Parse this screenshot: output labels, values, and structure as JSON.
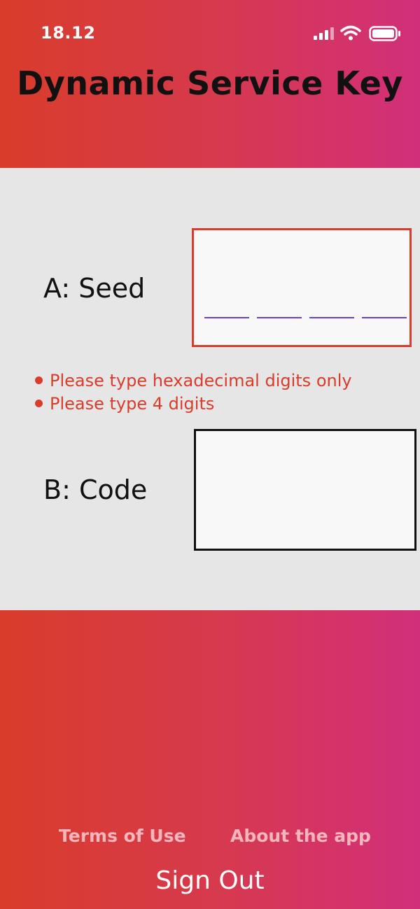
{
  "status_bar": {
    "time": "18.12",
    "icons": [
      "signal-icon",
      "wifi-icon",
      "battery-icon"
    ]
  },
  "header": {
    "title": "Dynamic Service Key"
  },
  "seed": {
    "label": "A: Seed",
    "value": "",
    "digit_slots": 4
  },
  "errors": [
    "Please type hexadecimal digits only",
    "Please type 4 digits"
  ],
  "code": {
    "label": "B: Code",
    "value": ""
  },
  "footer": {
    "terms_label": "Terms of Use",
    "about_label": "About the app",
    "signout_label": "Sign Out"
  },
  "colors": {
    "gradient_start": "#d93c2a",
    "gradient_end": "#d22f7a",
    "error": "#d93c2a",
    "slot_underline": "#6a3fd8",
    "link": "#f4b6bd"
  }
}
